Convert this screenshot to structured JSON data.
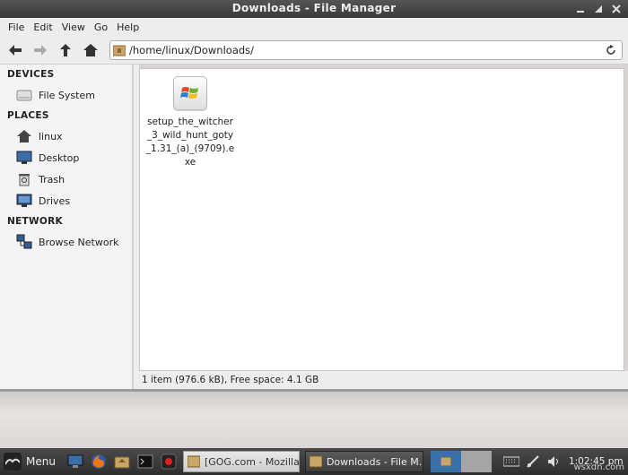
{
  "window": {
    "title": "Downloads - File Manager"
  },
  "menubar": {
    "items": [
      "File",
      "Edit",
      "View",
      "Go",
      "Help"
    ]
  },
  "location": {
    "path": "/home/linux/Downloads/"
  },
  "sidebar": {
    "devices_heading": "DEVICES",
    "devices": [
      {
        "label": "File System",
        "icon": "drive-icon"
      }
    ],
    "places_heading": "PLACES",
    "places": [
      {
        "label": "linux",
        "icon": "home-icon"
      },
      {
        "label": "Desktop",
        "icon": "desktop-icon"
      },
      {
        "label": "Trash",
        "icon": "trash-icon"
      },
      {
        "label": "Drives",
        "icon": "drives-icon"
      }
    ],
    "network_heading": "NETWORK",
    "network": [
      {
        "label": "Browse Network",
        "icon": "network-icon"
      }
    ]
  },
  "files": [
    {
      "name": "setup_the_witcher_3_wild_hunt_goty_1.31_(a)_(9709).exe",
      "icon": "windows-exe-icon"
    }
  ],
  "statusbar": {
    "text": "1 item (976.6 kB), Free space: 4.1 GB"
  },
  "taskbar": {
    "menu_label": "Menu",
    "tasks": [
      {
        "label": "[GOG.com - Mozilla ...",
        "active": false
      },
      {
        "label": "Downloads - File M...",
        "active": true
      }
    ],
    "clock": "1:02:45 pm"
  },
  "watermark": "wsxdn.com",
  "colors": {
    "titlebar": "#3a3a3a",
    "accent": "#3b6fa8",
    "sidebar_bg": "#f4f4f4"
  }
}
